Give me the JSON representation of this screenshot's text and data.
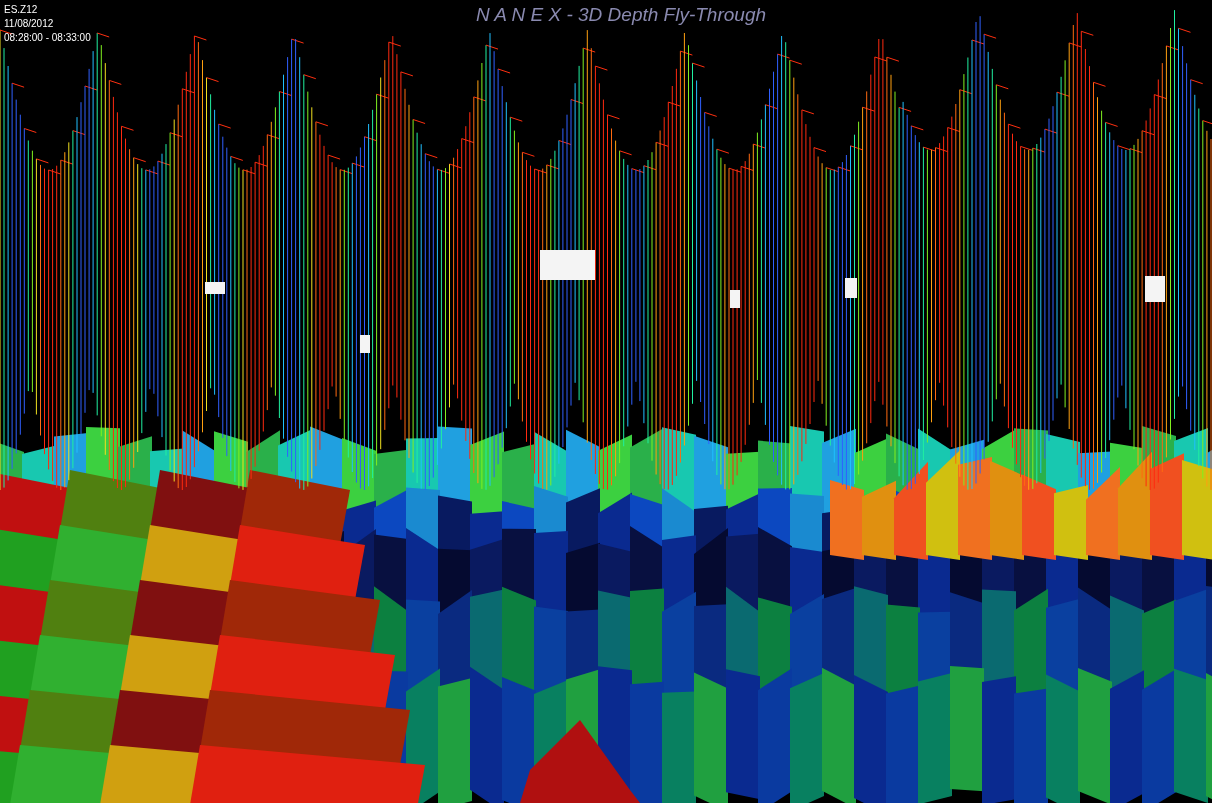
{
  "title": "N A N E X - 3D Depth Fly-Through",
  "info": {
    "symbol": "ES.Z12",
    "date": "11/08/2012",
    "time_range": "08:28:00 - 08:33:00"
  }
}
